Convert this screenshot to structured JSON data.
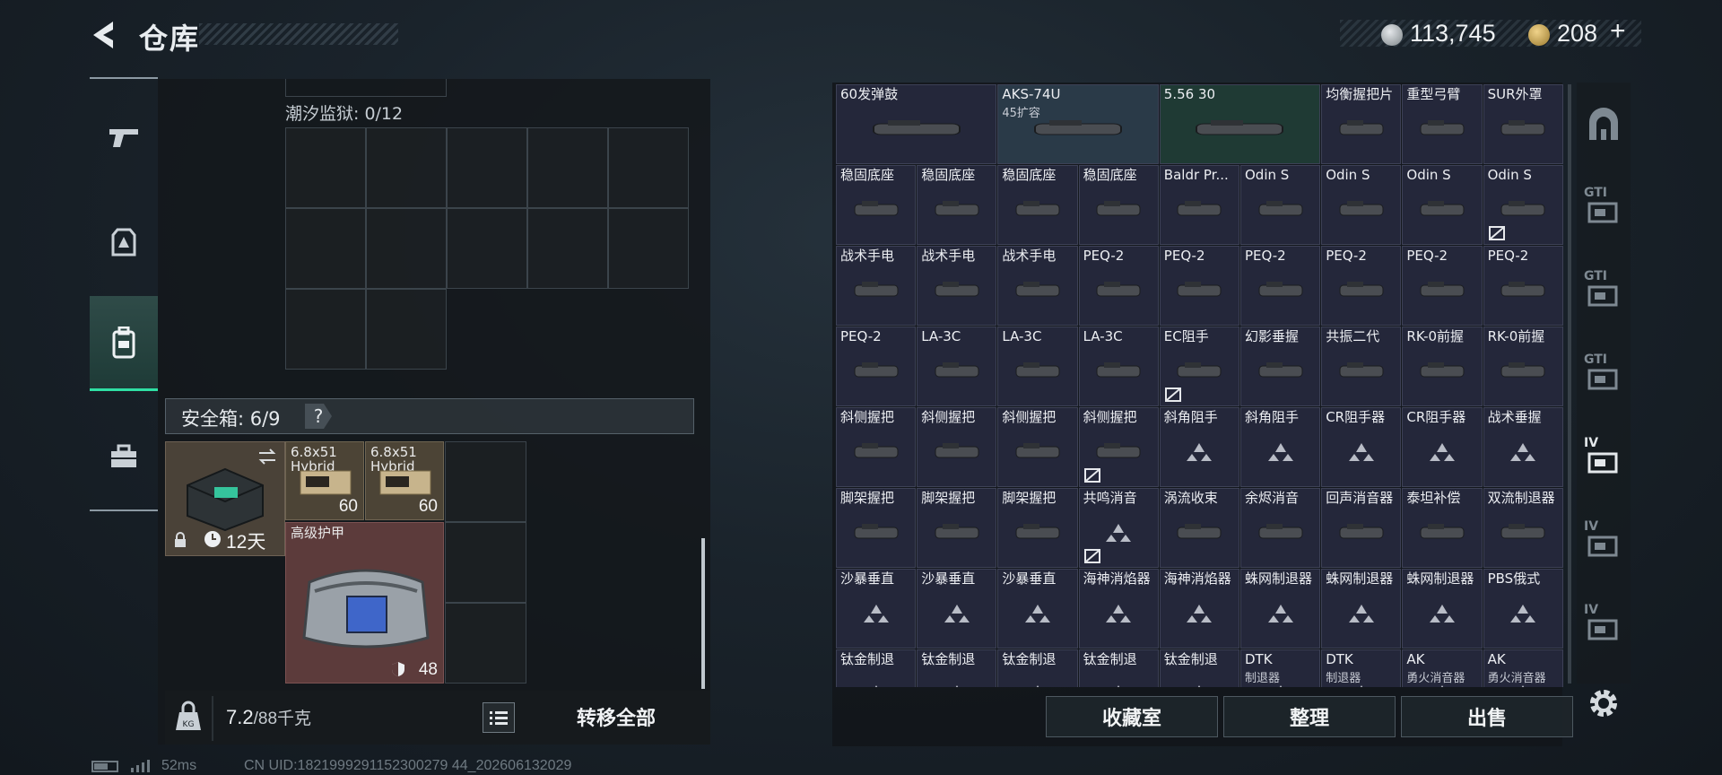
{
  "header": {
    "title": "仓库"
  },
  "currency": {
    "silver": "113,745",
    "gold": "208",
    "add": "+"
  },
  "left_rail": {
    "items": [
      "weapons",
      "armor",
      "backpack",
      "toolbox"
    ],
    "active_index": 2
  },
  "storage": {
    "tidal_prison_label": "潮汐监狱: 0/12",
    "safebox_label": "安全箱: 6/9",
    "safebox_help": "?",
    "safe_case_days": "12天",
    "ammo": [
      {
        "name": "6.8x51",
        "sub": "Hybrid",
        "count": "60"
      },
      {
        "name": "6.8x51",
        "sub": "Hybrid",
        "count": "60"
      }
    ],
    "armor": {
      "name": "高级护甲",
      "durability": "48"
    }
  },
  "weight": {
    "current": "7.2",
    "max": "/88千克"
  },
  "transfer_all_label": "转移全部",
  "inventory": {
    "rows": [
      [
        {
          "name": "60发弹鼓",
          "sub": ""
        },
        {
          "name": "AKS-74U",
          "sub": "45扩容"
        },
        {
          "name": "5.56 30",
          "sub": ""
        },
        {
          "name": "均衡握把片",
          "sub": ""
        },
        {
          "name": "重型弓臂",
          "sub": ""
        },
        {
          "name": "SUR外罩",
          "sub": ""
        }
      ],
      [
        {
          "name": "稳固底座",
          "sub": ""
        },
        {
          "name": "稳固底座",
          "sub": ""
        },
        {
          "name": "稳固底座",
          "sub": ""
        },
        {
          "name": "稳固底座",
          "sub": ""
        },
        {
          "name": "Baldr Pr...",
          "sub": ""
        },
        {
          "name": "Odin S",
          "sub": ""
        },
        {
          "name": "Odin S",
          "sub": ""
        },
        {
          "name": "Odin S",
          "sub": ""
        },
        {
          "name": "Odin S",
          "sub": "",
          "lock": true
        }
      ],
      [
        {
          "name": "战术手电",
          "sub": ""
        },
        {
          "name": "战术手电",
          "sub": ""
        },
        {
          "name": "战术手电",
          "sub": ""
        },
        {
          "name": "PEQ-2",
          "sub": ""
        },
        {
          "name": "PEQ-2",
          "sub": ""
        },
        {
          "name": "PEQ-2",
          "sub": ""
        },
        {
          "name": "PEQ-2",
          "sub": ""
        },
        {
          "name": "PEQ-2",
          "sub": ""
        },
        {
          "name": "PEQ-2",
          "sub": ""
        }
      ],
      [
        {
          "name": "PEQ-2",
          "sub": ""
        },
        {
          "name": "LA-3C",
          "sub": ""
        },
        {
          "name": "LA-3C",
          "sub": ""
        },
        {
          "name": "LA-3C",
          "sub": ""
        },
        {
          "name": "EC阻手",
          "sub": "",
          "lock": true
        },
        {
          "name": "幻影垂握",
          "sub": ""
        },
        {
          "name": "共振二代",
          "sub": ""
        },
        {
          "name": "RK-0前握",
          "sub": ""
        },
        {
          "name": "RK-0前握",
          "sub": ""
        }
      ],
      [
        {
          "name": "斜侧握把",
          "sub": ""
        },
        {
          "name": "斜侧握把",
          "sub": ""
        },
        {
          "name": "斜侧握把",
          "sub": ""
        },
        {
          "name": "斜侧握把",
          "sub": "",
          "lock": true
        },
        {
          "name": "斜角阻手",
          "sub": ""
        },
        {
          "name": "斜角阻手",
          "sub": ""
        },
        {
          "name": "CR阻手器",
          "sub": ""
        },
        {
          "name": "CR阻手器",
          "sub": ""
        },
        {
          "name": "战术垂握",
          "sub": ""
        }
      ],
      [
        {
          "name": "脚架握把",
          "sub": ""
        },
        {
          "name": "脚架握把",
          "sub": ""
        },
        {
          "name": "脚架握把",
          "sub": ""
        },
        {
          "name": "共鸣消音",
          "sub": "",
          "lock": true
        },
        {
          "name": "涡流收束",
          "sub": ""
        },
        {
          "name": "余烬消音",
          "sub": ""
        },
        {
          "name": "回声消音器",
          "sub": ""
        },
        {
          "name": "泰坦补偿",
          "sub": ""
        },
        {
          "name": "双流制退器",
          "sub": ""
        }
      ],
      [
        {
          "name": "沙暴垂直",
          "sub": ""
        },
        {
          "name": "沙暴垂直",
          "sub": ""
        },
        {
          "name": "沙暴垂直",
          "sub": ""
        },
        {
          "name": "海神消焰器",
          "sub": ""
        },
        {
          "name": "海神消焰器",
          "sub": ""
        },
        {
          "name": "蛛网制退器",
          "sub": ""
        },
        {
          "name": "蛛网制退器",
          "sub": ""
        },
        {
          "name": "蛛网制退器",
          "sub": ""
        },
        {
          "name": "PBS俄式",
          "sub": ""
        }
      ],
      [
        {
          "name": "钛金制退",
          "sub": ""
        },
        {
          "name": "钛金制退",
          "sub": ""
        },
        {
          "name": "钛金制退",
          "sub": ""
        },
        {
          "name": "钛金制退",
          "sub": ""
        },
        {
          "name": "钛金制退",
          "sub": ""
        },
        {
          "name": "DTK",
          "sub": "制退器"
        },
        {
          "name": "DTK",
          "sub": "制退器"
        },
        {
          "name": "AK",
          "sub": "勇火消音器"
        },
        {
          "name": "AK",
          "sub": "勇火消音器"
        }
      ]
    ]
  },
  "actions": {
    "collection": "收藏室",
    "organize": "整理",
    "deploy": "出售"
  },
  "right_rail": [
    {
      "label": "",
      "icon": "vault-icon"
    },
    {
      "label": "GTI",
      "icon": "gti-1-icon"
    },
    {
      "label": "GTI",
      "icon": "gti-2-icon"
    },
    {
      "label": "GTI",
      "icon": "gti-3-icon"
    },
    {
      "label": "IV",
      "icon": "iv-1-icon"
    },
    {
      "label": "IV",
      "icon": "iv-2-icon"
    },
    {
      "label": "IV",
      "icon": "iv-3-icon"
    }
  ],
  "status": {
    "ping": "52ms",
    "uid": "CN UID:1821999291152300279 44_202606132029"
  }
}
